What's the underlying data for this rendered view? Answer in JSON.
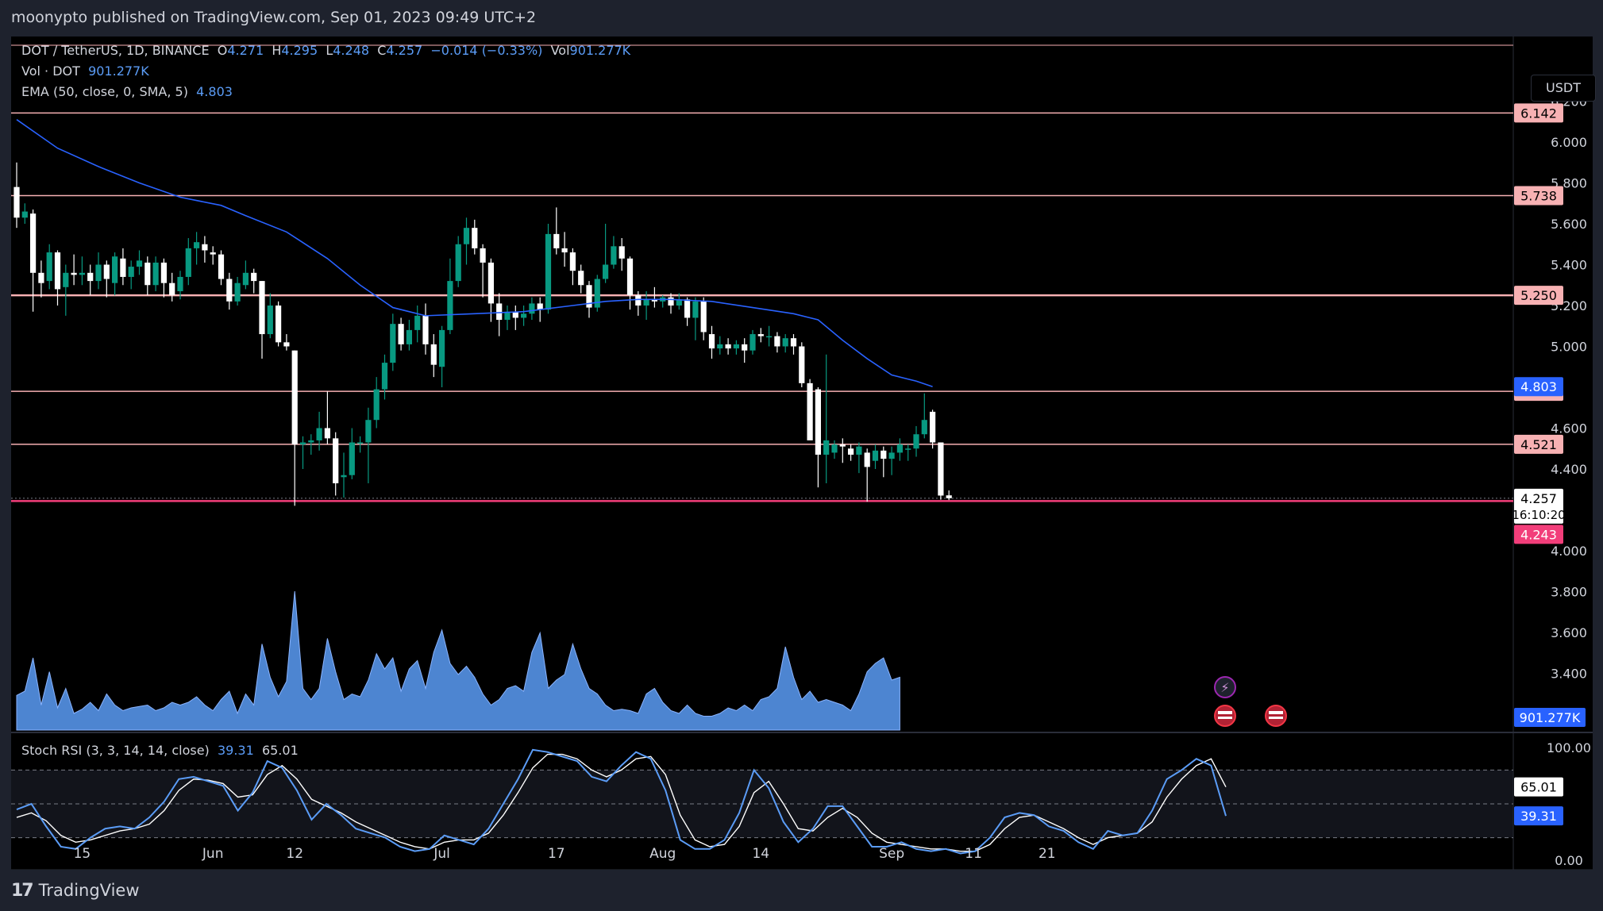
{
  "header": {
    "published": "moonypto published on TradingView.com, Sep 01, 2023 09:49 UTC+2"
  },
  "legend": {
    "symbol": "DOT / TetherUS, 1D, BINANCE",
    "open_label": "O",
    "open": "4.271",
    "high_label": "H",
    "high": "4.295",
    "low_label": "L",
    "low": "4.248",
    "close_label": "C",
    "close": "4.257",
    "change": "−0.014 (−0.33%)",
    "vol_label": "Vol",
    "vol": "901.277K",
    "volume_name": "Vol · DOT",
    "volume_value": "901.277K",
    "ema_name": "EMA (50, close, 0, SMA, 5)",
    "ema_value": "4.803",
    "stoch_name": "Stoch RSI (3, 3, 14, 14, close)",
    "stoch_k": "39.31",
    "stoch_d": "65.01"
  },
  "currency_button": "USDT",
  "footer": {
    "brand": "TradingView"
  },
  "colors": {
    "background": "#000000",
    "frame": "#1e222d",
    "bull": "#089981",
    "bear": "#ffffff",
    "ema": "#2962ff",
    "volume": "#5b9cf6",
    "level_line": "#f7b1b3",
    "support_line": "#f23e7a",
    "stoch_k": "#5b9cf6",
    "stoch_d": "#ffffff"
  },
  "chart_data": {
    "type": "candlestick",
    "price_axis": {
      "ticks": [
        "6.200",
        "6.000",
        "5.800",
        "5.600",
        "5.400",
        "5.200",
        "5.000",
        "4.600",
        "4.400",
        "4.000",
        "3.800",
        "3.600",
        "3.400"
      ],
      "tick_values": [
        6.2,
        6.0,
        5.8,
        5.6,
        5.4,
        5.2,
        5.0,
        4.6,
        4.4,
        4.0,
        3.8,
        3.6,
        3.4
      ],
      "range": [
        3.4,
        6.2
      ]
    },
    "time_axis": {
      "labels": [
        "15",
        "Jun",
        "12",
        "Jul",
        "17",
        "Aug",
        "14",
        "Sep",
        "11",
        "21"
      ],
      "label_bar_index": [
        8,
        24,
        34,
        52,
        66,
        79,
        91,
        107,
        117,
        126
      ]
    },
    "horizontal_levels": [
      {
        "value": 6.142,
        "label": "6.142"
      },
      {
        "value": 5.738,
        "label": "5.738"
      },
      {
        "value": 5.25,
        "label": "5.250"
      },
      {
        "value": 4.78,
        "label": "4.780"
      },
      {
        "value": 4.521,
        "label": "4.521"
      },
      {
        "value": 4.243,
        "label": "4.243",
        "support": true
      }
    ],
    "price_tags": [
      {
        "value": 4.803,
        "label": "4.803",
        "kind": "ema"
      },
      {
        "value": 4.257,
        "label": "4.257",
        "sub": "16:10:20",
        "kind": "last"
      }
    ],
    "volume_tag": "901.277K",
    "candles": [
      [
        5.78,
        5.63,
        5.9,
        5.58
      ],
      [
        5.63,
        5.66,
        5.7,
        5.6
      ],
      [
        5.65,
        5.36,
        5.67,
        5.17
      ],
      [
        5.36,
        5.31,
        5.42,
        5.24
      ],
      [
        5.32,
        5.46,
        5.5,
        5.28
      ],
      [
        5.46,
        5.28,
        5.47,
        5.2
      ],
      [
        5.29,
        5.36,
        5.4,
        5.15
      ],
      [
        5.36,
        5.35,
        5.45,
        5.3
      ],
      [
        5.35,
        5.36,
        5.44,
        5.3
      ],
      [
        5.36,
        5.32,
        5.4,
        5.25
      ],
      [
        5.32,
        5.4,
        5.46,
        5.28
      ],
      [
        5.4,
        5.33,
        5.42,
        5.24
      ],
      [
        5.31,
        5.44,
        5.46,
        5.25
      ],
      [
        5.43,
        5.34,
        5.48,
        5.3
      ],
      [
        5.34,
        5.39,
        5.42,
        5.28
      ],
      [
        5.39,
        5.42,
        5.47,
        5.35
      ],
      [
        5.41,
        5.3,
        5.44,
        5.25
      ],
      [
        5.3,
        5.41,
        5.44,
        5.27
      ],
      [
        5.41,
        5.31,
        5.43,
        5.24
      ],
      [
        5.31,
        5.25,
        5.36,
        5.22
      ],
      [
        5.27,
        5.34,
        5.37,
        5.23
      ],
      [
        5.34,
        5.48,
        5.53,
        5.3
      ],
      [
        5.48,
        5.51,
        5.56,
        5.4
      ],
      [
        5.5,
        5.47,
        5.54,
        5.41
      ],
      [
        5.46,
        5.45,
        5.49,
        5.4
      ],
      [
        5.45,
        5.33,
        5.47,
        5.3
      ],
      [
        5.33,
        5.22,
        5.36,
        5.18
      ],
      [
        5.22,
        5.31,
        5.34,
        5.2
      ],
      [
        5.3,
        5.36,
        5.42,
        5.28
      ],
      [
        5.36,
        5.32,
        5.38,
        5.26
      ],
      [
        5.32,
        5.06,
        5.32,
        4.94
      ],
      [
        5.06,
        5.2,
        5.26,
        5.04
      ],
      [
        5.2,
        5.02,
        5.22,
        5.0
      ],
      [
        5.02,
        5.0,
        5.06,
        4.98
      ],
      [
        4.98,
        4.52,
        4.98,
        4.22
      ],
      [
        4.52,
        4.53,
        4.56,
        4.4
      ],
      [
        4.53,
        4.54,
        4.57,
        4.47
      ],
      [
        4.54,
        4.6,
        4.68,
        4.49
      ],
      [
        4.6,
        4.55,
        4.78,
        4.52
      ],
      [
        4.55,
        4.33,
        4.58,
        4.27
      ],
      [
        4.36,
        4.37,
        4.48,
        4.26
      ],
      [
        4.37,
        4.53,
        4.6,
        4.35
      ],
      [
        4.53,
        4.53,
        4.56,
        4.48
      ],
      [
        4.53,
        4.64,
        4.7,
        4.33
      ],
      [
        4.64,
        4.79,
        4.85,
        4.6
      ],
      [
        4.79,
        4.92,
        4.96,
        4.74
      ],
      [
        4.92,
        5.11,
        5.16,
        4.88
      ],
      [
        5.11,
        5.01,
        5.14,
        4.98
      ],
      [
        5.01,
        5.08,
        5.13,
        4.98
      ],
      [
        5.08,
        5.15,
        5.2,
        5.02
      ],
      [
        5.15,
        5.01,
        5.21,
        4.96
      ],
      [
        5.01,
        4.91,
        5.06,
        4.85
      ],
      [
        4.9,
        5.08,
        5.1,
        4.8
      ],
      [
        5.08,
        5.32,
        5.43,
        5.06
      ],
      [
        5.32,
        5.5,
        5.54,
        5.29
      ],
      [
        5.5,
        5.58,
        5.63,
        5.4
      ],
      [
        5.58,
        5.48,
        5.62,
        5.45
      ],
      [
        5.48,
        5.41,
        5.5,
        5.24
      ],
      [
        5.41,
        5.21,
        5.43,
        5.12
      ],
      [
        5.21,
        5.13,
        5.26,
        5.05
      ],
      [
        5.13,
        5.17,
        5.2,
        5.08
      ],
      [
        5.17,
        5.14,
        5.2,
        5.08
      ],
      [
        5.14,
        5.16,
        5.2,
        5.1
      ],
      [
        5.16,
        5.21,
        5.24,
        5.13
      ],
      [
        5.21,
        5.18,
        5.24,
        5.12
      ],
      [
        5.18,
        5.55,
        5.6,
        5.16
      ],
      [
        5.55,
        5.48,
        5.68,
        5.45
      ],
      [
        5.48,
        5.46,
        5.56,
        5.39
      ],
      [
        5.46,
        5.37,
        5.48,
        5.3
      ],
      [
        5.37,
        5.3,
        5.4,
        5.26
      ],
      [
        5.3,
        5.19,
        5.32,
        5.14
      ],
      [
        5.19,
        5.33,
        5.35,
        5.17
      ],
      [
        5.33,
        5.4,
        5.6,
        5.31
      ],
      [
        5.4,
        5.49,
        5.54,
        5.38
      ],
      [
        5.49,
        5.43,
        5.53,
        5.37
      ],
      [
        5.43,
        5.25,
        5.44,
        5.18
      ],
      [
        5.25,
        5.2,
        5.27,
        5.15
      ],
      [
        5.2,
        5.23,
        5.27,
        5.13
      ],
      [
        5.23,
        5.22,
        5.29,
        5.19
      ],
      [
        5.22,
        5.24,
        5.25,
        5.19
      ],
      [
        5.24,
        5.2,
        5.26,
        5.16
      ],
      [
        5.2,
        5.23,
        5.26,
        5.18
      ],
      [
        5.23,
        5.14,
        5.24,
        5.1
      ],
      [
        5.14,
        5.22,
        5.24,
        5.03
      ],
      [
        5.22,
        5.07,
        5.24,
        5.03
      ],
      [
        5.06,
        4.99,
        5.1,
        4.94
      ],
      [
        4.99,
        5.01,
        5.05,
        4.96
      ],
      [
        5.01,
        4.99,
        5.04,
        4.96
      ],
      [
        4.99,
        5.01,
        5.03,
        4.96
      ],
      [
        5.01,
        4.98,
        5.04,
        4.92
      ],
      [
        4.98,
        5.06,
        5.08,
        4.96
      ],
      [
        5.06,
        5.05,
        5.09,
        5.02
      ],
      [
        5.05,
        5.05,
        5.1,
        5.0
      ],
      [
        5.05,
        5.0,
        5.07,
        4.97
      ],
      [
        5.0,
        5.04,
        5.06,
        4.97
      ],
      [
        5.04,
        5.0,
        5.06,
        4.96
      ],
      [
        5.0,
        4.82,
        5.02,
        4.8
      ],
      [
        4.82,
        4.54,
        4.84,
        4.6
      ],
      [
        4.79,
        4.47,
        4.8,
        4.31
      ],
      [
        4.47,
        4.54,
        4.96,
        4.33
      ],
      [
        4.48,
        4.52,
        4.54,
        4.45
      ],
      [
        4.52,
        4.51,
        4.55,
        4.43
      ],
      [
        4.5,
        4.47,
        4.52,
        4.44
      ],
      [
        4.47,
        4.51,
        4.53,
        4.38
      ],
      [
        4.48,
        4.41,
        4.5,
        4.24
      ],
      [
        4.44,
        4.49,
        4.52,
        4.4
      ],
      [
        4.49,
        4.45,
        4.51,
        4.36
      ],
      [
        4.45,
        4.48,
        4.51,
        4.37
      ],
      [
        4.48,
        4.52,
        4.55,
        4.44
      ]
    ],
    "recent_candles": [
      [
        4.5,
        4.5,
        4.52,
        4.44
      ],
      [
        4.5,
        4.57,
        4.61,
        4.46
      ],
      [
        4.57,
        4.64,
        4.77,
        4.55
      ],
      [
        4.68,
        4.53,
        4.69,
        4.5
      ],
      [
        4.53,
        4.27,
        4.53,
        4.25
      ],
      [
        4.271,
        4.257,
        4.295,
        4.248
      ]
    ],
    "ema": [
      [
        0,
        6.11
      ],
      [
        5,
        5.97
      ],
      [
        10,
        5.88
      ],
      [
        15,
        5.8
      ],
      [
        20,
        5.73
      ],
      [
        25,
        5.69
      ],
      [
        28,
        5.64
      ],
      [
        33,
        5.56
      ],
      [
        38,
        5.43
      ],
      [
        42,
        5.3
      ],
      [
        46,
        5.19
      ],
      [
        50,
        5.15
      ],
      [
        56,
        5.16
      ],
      [
        62,
        5.17
      ],
      [
        68,
        5.2
      ],
      [
        72,
        5.22
      ],
      [
        76,
        5.23
      ],
      [
        80,
        5.23
      ],
      [
        85,
        5.22
      ],
      [
        90,
        5.19
      ],
      [
        95,
        5.16
      ],
      [
        98,
        5.13
      ],
      [
        101,
        5.03
      ],
      [
        104,
        4.94
      ],
      [
        107,
        4.86
      ],
      [
        110,
        4.83
      ],
      [
        112,
        4.803
      ]
    ],
    "volume": [
      0.25,
      0.28,
      0.52,
      0.18,
      0.42,
      0.16,
      0.3,
      0.12,
      0.15,
      0.2,
      0.14,
      0.26,
      0.18,
      0.14,
      0.16,
      0.17,
      0.18,
      0.14,
      0.16,
      0.2,
      0.18,
      0.2,
      0.24,
      0.18,
      0.14,
      0.22,
      0.28,
      0.12,
      0.26,
      0.18,
      0.62,
      0.38,
      0.24,
      0.35,
      1.0,
      0.3,
      0.22,
      0.3,
      0.66,
      0.42,
      0.22,
      0.26,
      0.24,
      0.36,
      0.55,
      0.44,
      0.52,
      0.28,
      0.44,
      0.5,
      0.3,
      0.56,
      0.72,
      0.48,
      0.4,
      0.46,
      0.38,
      0.26,
      0.18,
      0.22,
      0.3,
      0.32,
      0.28,
      0.56,
      0.7,
      0.3,
      0.36,
      0.4,
      0.62,
      0.44,
      0.3,
      0.26,
      0.18,
      0.14,
      0.15,
      0.14,
      0.12,
      0.26,
      0.3,
      0.2,
      0.14,
      0.12,
      0.18,
      0.12,
      0.1,
      0.1,
      0.12,
      0.16,
      0.14,
      0.18,
      0.14,
      0.22,
      0.24,
      0.3,
      0.6,
      0.38,
      0.22,
      0.28,
      0.2,
      0.22,
      0.2,
      0.18,
      0.14,
      0.26,
      0.42,
      0.48,
      0.52,
      0.36,
      0.38
    ],
    "stoch_rsi": {
      "upper_band": 80,
      "middle_band": 50,
      "lower_band": 20,
      "ticks": [
        "100.00",
        "0.00"
      ],
      "tags": [
        {
          "value": 65.01,
          "label": "65.01",
          "series": "d"
        },
        {
          "value": 39.31,
          "label": "39.31",
          "series": "k"
        }
      ],
      "k": [
        45,
        50,
        30,
        12,
        10,
        20,
        28,
        30,
        28,
        38,
        52,
        72,
        74,
        70,
        66,
        44,
        60,
        88,
        82,
        62,
        36,
        50,
        40,
        28,
        24,
        20,
        12,
        8,
        10,
        22,
        18,
        14,
        28,
        50,
        72,
        98,
        96,
        92,
        88,
        74,
        70,
        84,
        96,
        90,
        62,
        18,
        10,
        10,
        18,
        42,
        80,
        64,
        34,
        16,
        28,
        48,
        48,
        30,
        12,
        12,
        16,
        10,
        8,
        10,
        6,
        8,
        20,
        38,
        42,
        40,
        30,
        26,
        16,
        10,
        26,
        22,
        24,
        44,
        72,
        80,
        90,
        84,
        39.31
      ],
      "d": [
        38,
        42,
        35,
        22,
        16,
        18,
        22,
        26,
        28,
        32,
        44,
        62,
        72,
        71,
        68,
        56,
        58,
        76,
        84,
        72,
        54,
        48,
        42,
        34,
        28,
        22,
        16,
        12,
        10,
        16,
        18,
        18,
        24,
        40,
        60,
        82,
        94,
        94,
        90,
        80,
        74,
        80,
        90,
        92,
        76,
        40,
        18,
        12,
        14,
        30,
        60,
        70,
        50,
        28,
        26,
        38,
        46,
        38,
        24,
        16,
        14,
        12,
        10,
        10,
        8,
        8,
        14,
        28,
        38,
        40,
        34,
        28,
        20,
        14,
        20,
        22,
        24,
        34,
        56,
        72,
        84,
        90,
        65.01
      ]
    }
  }
}
